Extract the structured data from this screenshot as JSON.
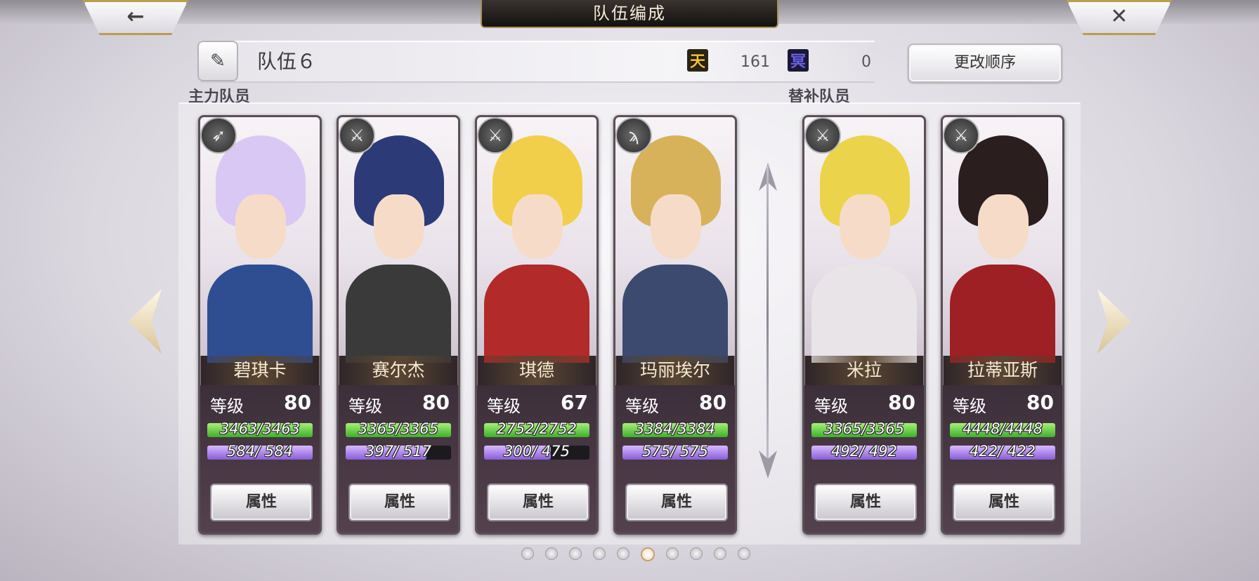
{
  "header": {
    "title": "队伍编成",
    "back_glyph": "←",
    "close_glyph": "✕"
  },
  "team": {
    "name": "队伍６",
    "sky_icon_text": "天",
    "sky_value": "161",
    "hell_icon_text": "冥",
    "hell_value": "0",
    "reorder_label": "更改顺序"
  },
  "sections": {
    "main_label": "主力队员",
    "sub_label": "替补队员"
  },
  "labels": {
    "level": "等级",
    "attribute": "属性"
  },
  "cards": [
    {
      "name": "碧琪卡",
      "level": "80",
      "hp": "3463/3463",
      "hp_ratio": 1.0,
      "mp": "584/ 584",
      "mp_ratio": 1.0,
      "weapon_icon": "bow-icon",
      "weapon_glyph": "➶",
      "hair": "#d9c8f4",
      "body": "#2f4e92"
    },
    {
      "name": "赛尔杰",
      "level": "80",
      "hp": "3365/3365",
      "hp_ratio": 1.0,
      "mp": "397/ 517",
      "mp_ratio": 0.768,
      "weapon_icon": "sword-icon",
      "weapon_glyph": "⚔",
      "hair": "#2c3a78",
      "body": "#3a3a3a"
    },
    {
      "name": "琪德",
      "level": "67",
      "hp": "2752/2752",
      "hp_ratio": 1.0,
      "mp": "300/ 475",
      "mp_ratio": 0.632,
      "weapon_icon": "dagger-icon",
      "weapon_glyph": "⚔",
      "hair": "#f2cf4a",
      "body": "#b22a2a"
    },
    {
      "name": "玛丽埃尔",
      "level": "80",
      "hp": "3384/3384",
      "hp_ratio": 1.0,
      "mp": "575/ 575",
      "mp_ratio": 1.0,
      "weapon_icon": "staff-icon",
      "weapon_glyph": "ϡ",
      "hair": "#d7b25a",
      "body": "#3b4a6e"
    },
    {
      "name": "米拉",
      "level": "80",
      "hp": "3365/3365",
      "hp_ratio": 1.0,
      "mp": "492/ 492",
      "mp_ratio": 1.0,
      "weapon_icon": "sword-icon",
      "weapon_glyph": "⚔",
      "hair": "#ecd34c",
      "body": "#e8e4e8"
    },
    {
      "name": "拉蒂亚斯",
      "level": "80",
      "hp": "4448/4448",
      "hp_ratio": 1.0,
      "mp": "422/ 422",
      "mp_ratio": 1.0,
      "weapon_icon": "sword-icon",
      "weapon_glyph": "⚔",
      "hair": "#2a1e1e",
      "body": "#9e1f24"
    }
  ],
  "pagination": {
    "total": 10,
    "active_index": 5
  }
}
